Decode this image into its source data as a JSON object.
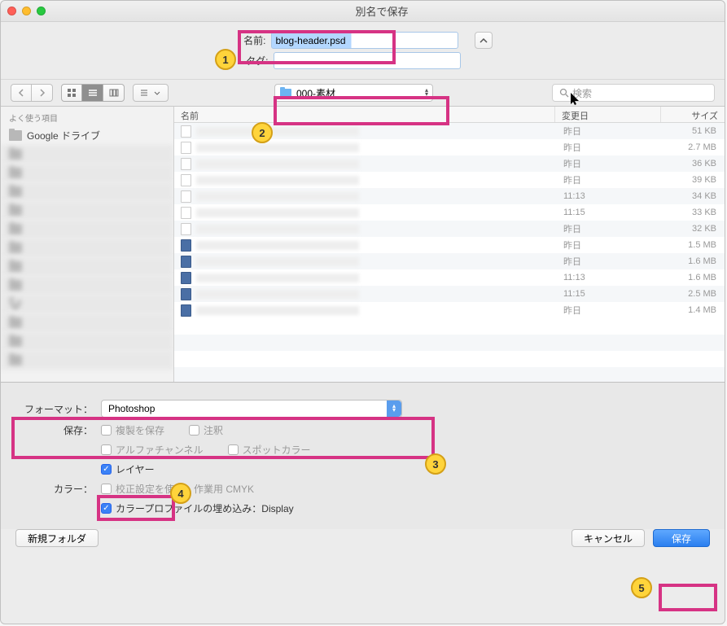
{
  "title": "別名で保存",
  "name_label": "名前:",
  "name_value": "blog-header.psd",
  "tag_label": "タグ:",
  "folder_name": "000-素材",
  "search_placeholder": "検索",
  "sidebar": {
    "header": "よく使う項目",
    "items": [
      "Google ドライブ",
      "",
      "",
      "",
      "",
      "",
      "",
      "",
      "",
      "",
      "",
      "",
      ""
    ]
  },
  "columns": {
    "name": "名前",
    "date": "変更日",
    "size": "サイズ"
  },
  "rows": [
    {
      "kind": "f",
      "date": "昨日",
      "size": "51 KB"
    },
    {
      "kind": "f",
      "date": "昨日",
      "size": "2.7 MB"
    },
    {
      "kind": "f",
      "date": "昨日",
      "size": "36 KB"
    },
    {
      "kind": "f",
      "date": "昨日",
      "size": "39 KB"
    },
    {
      "kind": "f",
      "date": "11:13",
      "size": "34 KB"
    },
    {
      "kind": "f",
      "date": "11:15",
      "size": "33 KB"
    },
    {
      "kind": "f",
      "date": "昨日",
      "size": "32 KB"
    },
    {
      "kind": "ps",
      "date": "昨日",
      "size": "1.5 MB"
    },
    {
      "kind": "ps",
      "date": "昨日",
      "size": "1.6 MB"
    },
    {
      "kind": "ps",
      "date": "11:13",
      "size": "1.6 MB"
    },
    {
      "kind": "ps",
      "date": "11:15",
      "size": "2.5 MB"
    },
    {
      "kind": "ps",
      "date": "昨日",
      "size": "1.4 MB"
    }
  ],
  "format_label": "フォーマット：",
  "format_value": "Photoshop",
  "save_label": "保存：",
  "dup_label": "複製を保存",
  "annot_label": "注釈",
  "alpha_label": "アルファチャンネル",
  "spot_label": "スポットカラー",
  "layer_label": "レイヤー",
  "color_label": "カラー：",
  "proof_label": "校正設定を使用：作業用 CMYK",
  "profile_label": "カラープロファイルの埋め込み：Display",
  "new_folder": "新規フォルダ",
  "cancel": "キャンセル",
  "save": "保存",
  "badges": [
    "1",
    "2",
    "3",
    "4",
    "5"
  ]
}
